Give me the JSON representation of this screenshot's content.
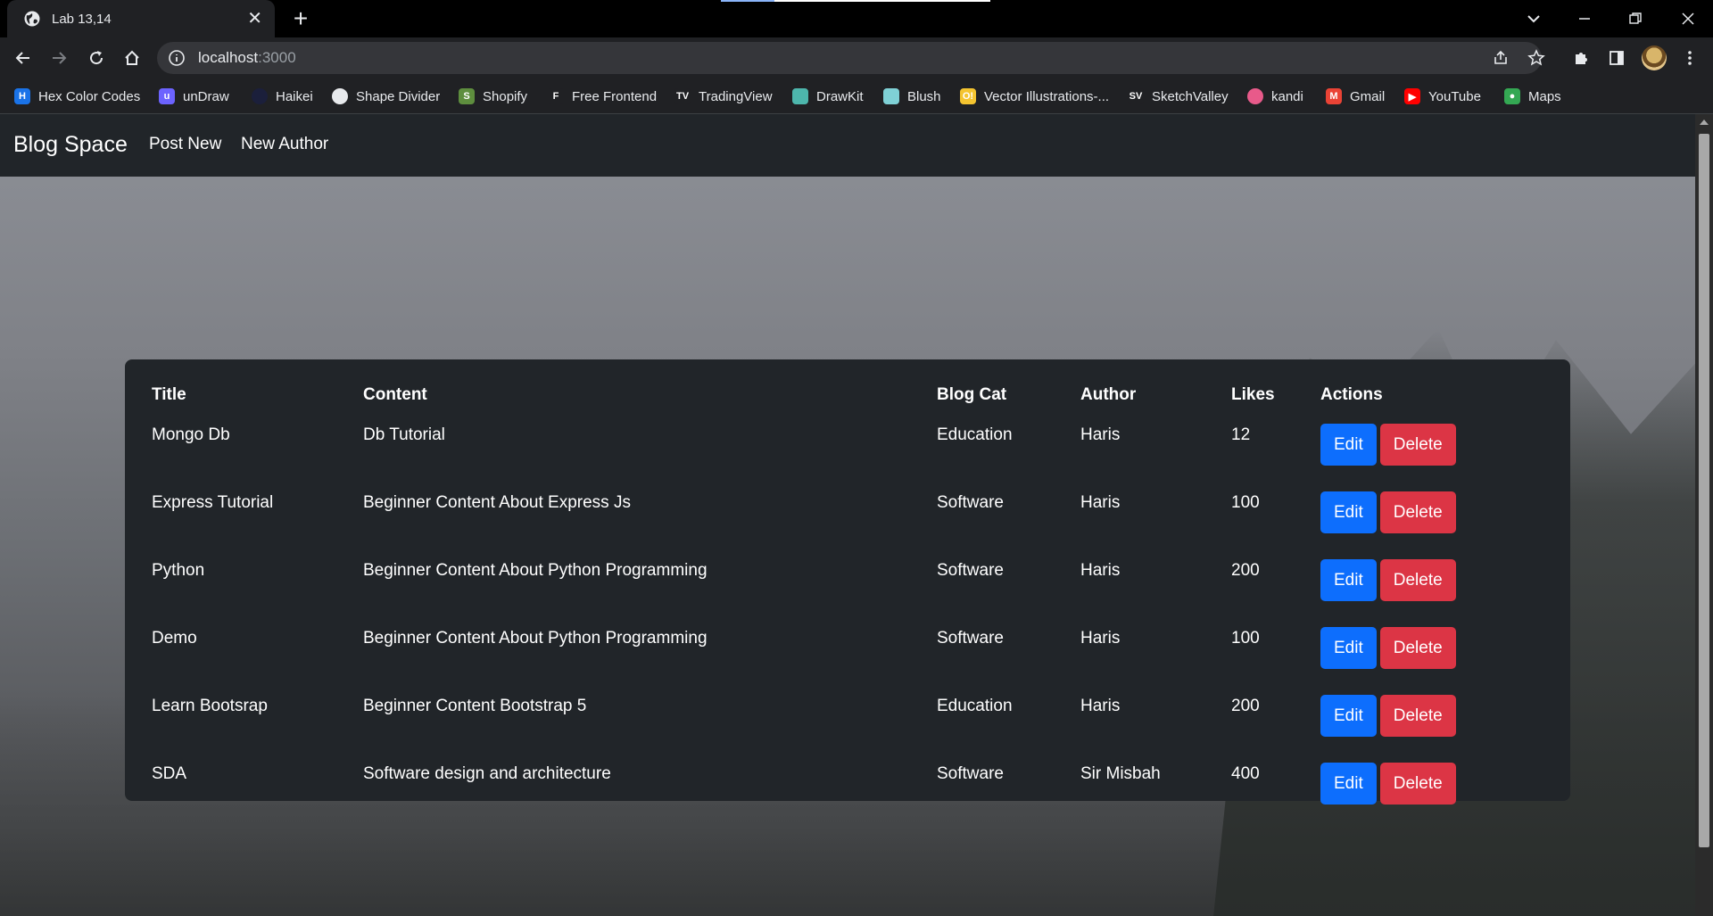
{
  "browser": {
    "tab_title": "Lab 13,14",
    "url_host": "localhost",
    "url_port": ":3000"
  },
  "bookmarks": [
    {
      "label": "Hex Color Codes",
      "icon": "hex-color-codes-icon",
      "color": "#1a73e8",
      "glyph": "H"
    },
    {
      "label": "unDraw",
      "icon": "undraw-icon",
      "color": "#6c63ff",
      "glyph": "u"
    },
    {
      "label": "Haikei",
      "icon": "haikei-icon",
      "color": "#1b1f3b",
      "glyph": ""
    },
    {
      "label": "Shape Divider",
      "icon": "shape-divider-icon",
      "color": "#e8eaed",
      "glyph": ""
    },
    {
      "label": "Shopify",
      "icon": "shopify-icon",
      "color": "#5e8e3e",
      "glyph": "S"
    },
    {
      "label": "Free Frontend",
      "icon": "free-frontend-icon",
      "color": "#202124",
      "glyph": "F"
    },
    {
      "label": "TradingView",
      "icon": "tradingview-icon",
      "color": "#202124",
      "glyph": "TV"
    },
    {
      "label": "DrawKit",
      "icon": "drawkit-icon",
      "color": "#4db6ac",
      "glyph": ""
    },
    {
      "label": "Blush",
      "icon": "blush-icon",
      "color": "#7fd1d6",
      "glyph": ""
    },
    {
      "label": "Vector Illustrations-...",
      "icon": "vector-illustrations-icon",
      "color": "#f4c430",
      "glyph": "O!"
    },
    {
      "label": "SketchValley",
      "icon": "sketchvalley-icon",
      "color": "#202124",
      "glyph": "SV"
    },
    {
      "label": "kandi",
      "icon": "kandi-icon",
      "color": "#e85a8a",
      "glyph": ""
    },
    {
      "label": "Gmail",
      "icon": "gmail-icon",
      "color": "#ea4335",
      "glyph": "M"
    },
    {
      "label": "YouTube",
      "icon": "youtube-icon",
      "color": "#ff0000",
      "glyph": "▶"
    },
    {
      "label": "Maps",
      "icon": "maps-icon",
      "color": "#34a853",
      "glyph": "●"
    }
  ],
  "site": {
    "brand": "Blog Space",
    "nav": [
      "Post New",
      "New Author"
    ]
  },
  "table": {
    "headers": [
      "Title",
      "Content",
      "Blog Cat",
      "Author",
      "Likes",
      "Actions"
    ],
    "rows": [
      {
        "title": "Mongo Db",
        "content": "Db Tutorial",
        "category": "Education",
        "author": "Haris",
        "likes": "12"
      },
      {
        "title": "Express Tutorial",
        "content": "Beginner Content About Express Js",
        "category": "Software",
        "author": "Haris",
        "likes": "100"
      },
      {
        "title": "Python",
        "content": "Beginner Content About Python Programming",
        "category": "Software",
        "author": "Haris",
        "likes": "200"
      },
      {
        "title": "Demo",
        "content": "Beginner Content About Python Programming",
        "category": "Software",
        "author": "Haris",
        "likes": "100"
      },
      {
        "title": "Learn Bootsrap",
        "content": "Beginner Content Bootstrap 5",
        "category": "Education",
        "author": "Haris",
        "likes": "200"
      },
      {
        "title": "SDA",
        "content": "Software design and architecture",
        "category": "Software",
        "author": "Sir Misbah",
        "likes": "400"
      }
    ],
    "edit_label": "Edit",
    "delete_label": "Delete"
  },
  "colors": {
    "navbar": "#212529",
    "edit_button": "#0d6efd",
    "delete_button": "#dc3545"
  }
}
